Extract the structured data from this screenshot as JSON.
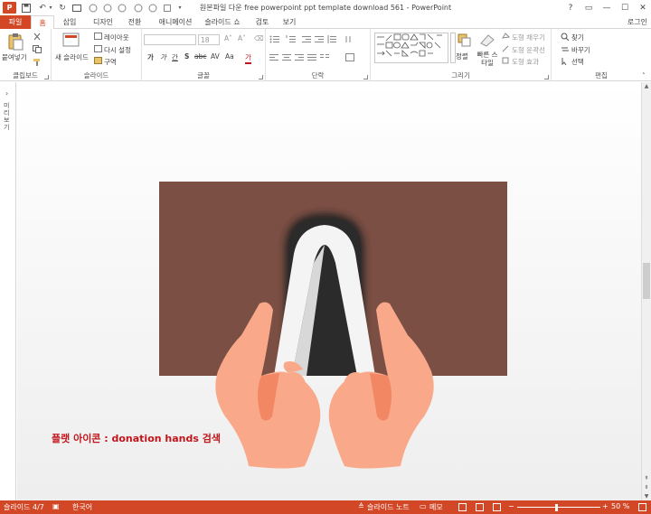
{
  "titlebar": {
    "app_icon": "P",
    "title": "원본파일 다운 free powerpoint ppt template download 561 - PowerPoint",
    "window_buttons": [
      "?",
      "▭",
      "—",
      "☐",
      "✕"
    ]
  },
  "tabs": {
    "items": [
      "파일",
      "홈",
      "삽입",
      "디자인",
      "전환",
      "애니메이션",
      "슬라이드 쇼",
      "검토",
      "보기"
    ],
    "active": "홈",
    "login": "로그인"
  },
  "ribbon": {
    "clipboard": {
      "paste": "붙여넣기",
      "label": "클립보드"
    },
    "slides": {
      "new_slide": "새 슬라이드",
      "layout": "레이아웃",
      "reset": "다시 설정",
      "section": "구역",
      "label": "슬라이드"
    },
    "font": {
      "size": "18",
      "bold": "가",
      "italic": "가",
      "underline": "간",
      "strike": "S",
      "spacing": "abc",
      "case": "Aa",
      "fontcolor": "가",
      "label": "글꼴"
    },
    "paragraph": {
      "label": "단락"
    },
    "drawing": {
      "arrange": "정렬",
      "quick_styles": "빠른 스타일",
      "shape_fill": "도형 채우기",
      "shape_outline": "도형 윤곽선",
      "shape_effects": "도형 효과",
      "label": "그리기"
    },
    "editing": {
      "find": "찾기",
      "replace": "바꾸기",
      "select": "선택",
      "label": "편집"
    }
  },
  "leftpane": {
    "label": "미리 보기",
    "collapse": "›"
  },
  "slide": {
    "caption": "플랫 아이콘 : donation hands 검색",
    "colors": {
      "brown": "#7b4f44",
      "hand": "#f9a98a",
      "hand_shade": "#f18763",
      "caption": "#c0151b"
    }
  },
  "status": {
    "slide": "슬라이드 4/7",
    "language": "한국어",
    "notes": "슬라이드 노트",
    "comments": "메모",
    "zoom": "50 %"
  }
}
